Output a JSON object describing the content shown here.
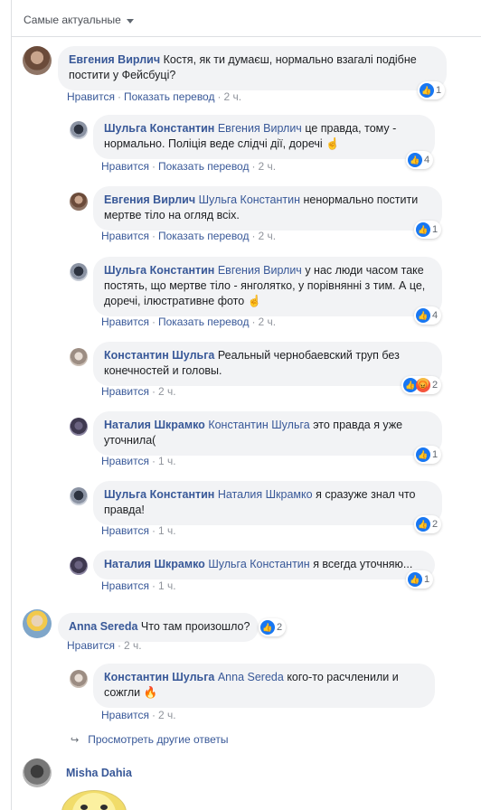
{
  "sort_label": "Самые актуальные",
  "actions": {
    "like": "Нравится",
    "translate": "Показать перевод"
  },
  "comments": [
    {
      "id": "c1",
      "author": "Евгения Вирлич",
      "tag": "",
      "text": "Костя, як ти думаєш, нормально взагалі подібне постити у Фейсбуці?",
      "time": "2 ч.",
      "translate": true,
      "reactions": "1",
      "avatar_icon": "woman-avatar"
    },
    {
      "id": "c2",
      "author": "Шульга Константин",
      "tag": "Евгения Вирлич",
      "text": "це правда, тому - нормально. Поліція веде слідчі дії, доречі ☝",
      "time": "2 ч.",
      "translate": true,
      "reactions": "4",
      "avatar_icon": "man-avatar"
    },
    {
      "id": "c3",
      "author": "Евгения Вирлич",
      "tag": "Шульга Константин",
      "text": "ненормально постити мертве тіло на огляд всіх.",
      "time": "2 ч.",
      "translate": true,
      "reactions": "1",
      "avatar_icon": "woman-avatar"
    },
    {
      "id": "c4",
      "author": "Шульга Константин",
      "tag": "Евгения Вирлич",
      "text": "у нас люди часом таке постять, що мертве тіло - янголятко, у порівнянні з тим. А це, доречі, ілюстративне фото ☝",
      "time": "2 ч.",
      "translate": true,
      "reactions": "4",
      "avatar_icon": "man-avatar"
    },
    {
      "id": "c5",
      "author": "Константин Шульга",
      "tag": "",
      "text": "Реальный чернобаевский труп без конечностей и головы.",
      "time": "2 ч.",
      "translate": false,
      "reactions": "2",
      "avatar_icon": "man-avatar"
    },
    {
      "id": "c6",
      "author": "Наталия Шкрамко",
      "tag": "Константин Шульга",
      "text": "это правда я уже уточнила(",
      "time": "1 ч.",
      "translate": false,
      "reactions": "1",
      "avatar_icon": "woman-avatar"
    },
    {
      "id": "c7",
      "author": "Шульга Константин",
      "tag": "Наталия Шкрамко",
      "text": "я сразуже знал что правда!",
      "time": "1 ч.",
      "translate": false,
      "reactions": "2",
      "avatar_icon": "man-avatar"
    },
    {
      "id": "c8",
      "author": "Наталия Шкрамко",
      "tag": "Шульга Константин",
      "text": "я всегда уточняю...",
      "time": "1 ч.",
      "translate": false,
      "reactions": "1",
      "avatar_icon": "woman-avatar"
    },
    {
      "id": "c9",
      "author": "Anna Sereda",
      "tag": "",
      "text": "Что там произошло?",
      "time": "2 ч.",
      "translate": false,
      "reactions": "2",
      "avatar_icon": "woman-avatar"
    },
    {
      "id": "c10",
      "author": "Константин Шульга",
      "tag": "Anna Sereda",
      "text": "кого-то расчленили и сожгли 🔥",
      "time": "2 ч.",
      "translate": false,
      "reactions": "",
      "avatar_icon": "man-avatar"
    }
  ],
  "more_replies_label": "Просмотреть другие ответы",
  "last_author": "Misha Dahia",
  "colors": {
    "link": "#385898",
    "bubble": "#f2f3f5",
    "like": "#1877f2",
    "meta": "#90949c"
  }
}
